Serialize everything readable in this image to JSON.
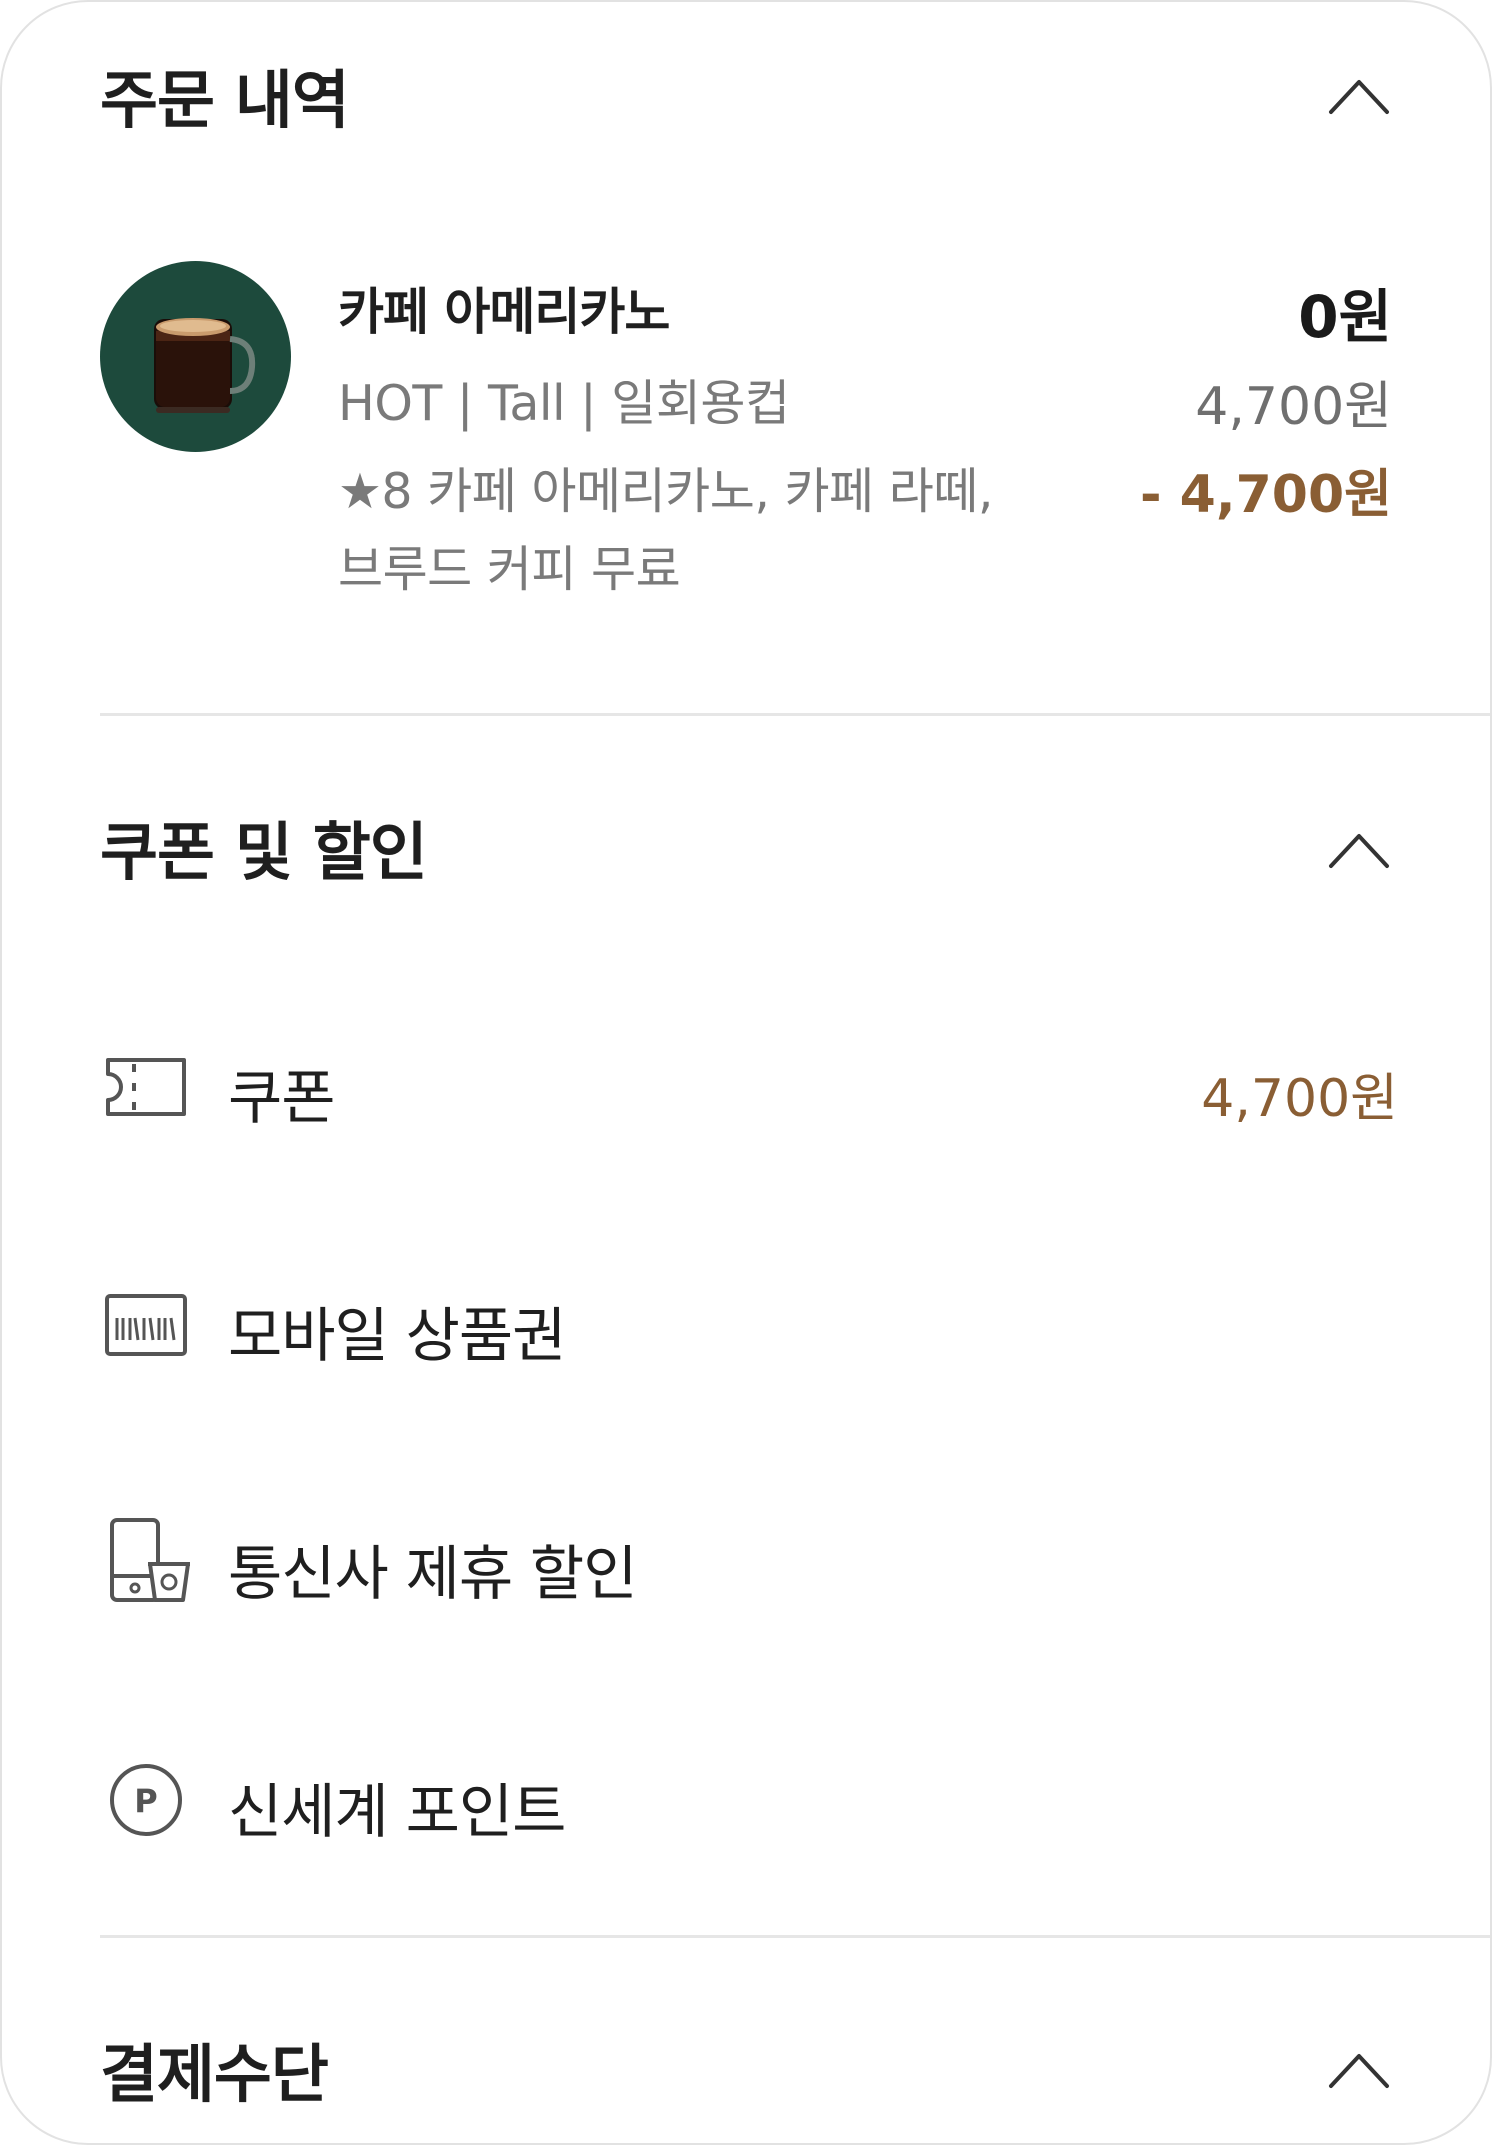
{
  "order_section": {
    "title": "주문 내역",
    "item": {
      "name": "카페 아메리카노",
      "options": "HOT | Tall | 일회용컵",
      "reward_line1": "★8 카페 아메리카노, 카페 라떼,",
      "reward_line2": "브루드 커피 무료",
      "final_price": "0원",
      "original_price": "4,700원",
      "discount": "- 4,700원"
    }
  },
  "coupon_section": {
    "title": "쿠폰 및 할인",
    "rows": [
      {
        "label": "쿠폰",
        "value": "4,700원",
        "icon": "ticket-icon"
      },
      {
        "label": "모바일 상품권",
        "value": "",
        "icon": "gift-card-barcode-icon"
      },
      {
        "label": "통신사 제휴 할인",
        "value": "",
        "icon": "phone-cup-icon"
      },
      {
        "label": "신세계 포인트",
        "value": "",
        "icon": "point-p-icon"
      }
    ]
  },
  "payment_section": {
    "title": "결제수단"
  },
  "colors": {
    "accent_brown": "#8a5e34",
    "thumb_green": "#1d4a3c",
    "divider": "#e6e6e6"
  }
}
